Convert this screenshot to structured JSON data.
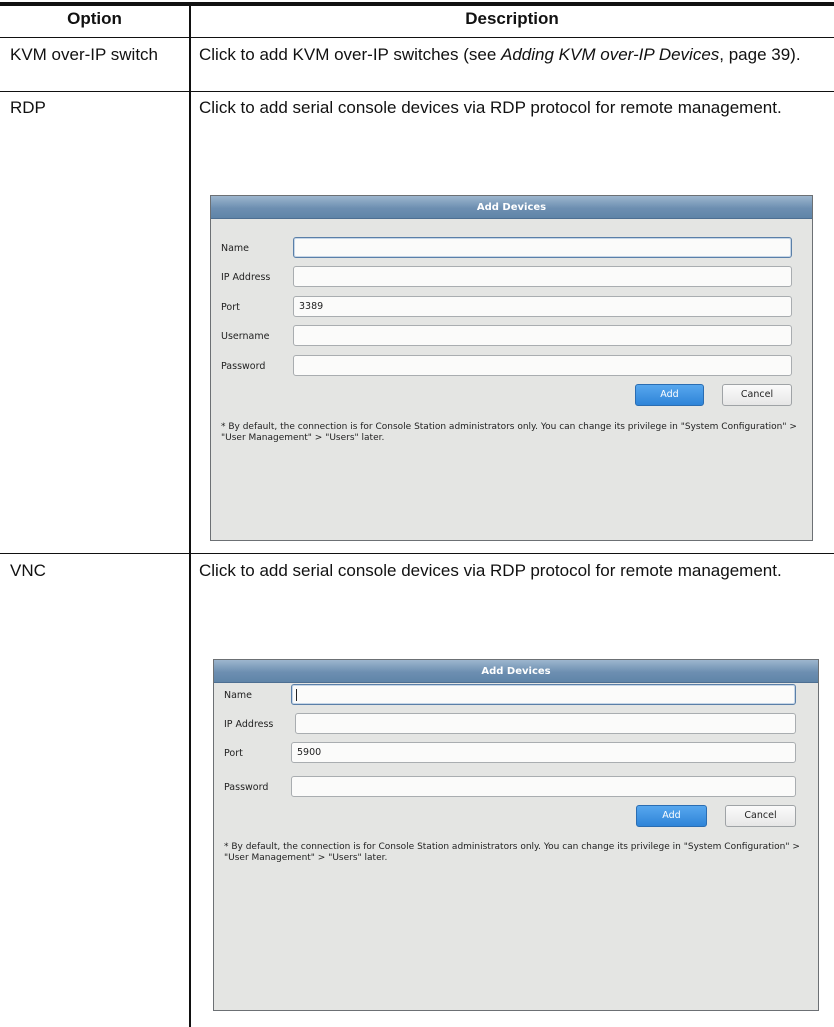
{
  "table": {
    "headers": {
      "option": "Option",
      "description": "Description"
    },
    "rows": [
      {
        "option": "KVM over-IP switch",
        "desc_pre": "Click to add KVM over-IP switches (see ",
        "desc_link": "Adding KVM over-IP Devices",
        "desc_post": ", page 39)."
      },
      {
        "option": "RDP",
        "description": "Click to add serial console devices via RDP protocol for remote management."
      },
      {
        "option": "VNC",
        "description": "Click to add serial console devices via RDP protocol for remote management."
      }
    ]
  },
  "dialogs": {
    "rdp": {
      "title": "Add Devices",
      "fields": [
        {
          "label": "Name",
          "value": ""
        },
        {
          "label": "IP Address",
          "value": ""
        },
        {
          "label": "Port",
          "value": "3389"
        },
        {
          "label": "Username",
          "value": ""
        },
        {
          "label": "Password",
          "value": ""
        }
      ],
      "add_label": "Add",
      "cancel_label": "Cancel",
      "note": "* By default, the connection is for Console Station administrators only. You can change its privilege in \"System Configuration\" > \"User Management\" > \"Users\" later."
    },
    "vnc": {
      "title": "Add Devices",
      "fields": [
        {
          "label": "Name",
          "value": ""
        },
        {
          "label": "IP Address",
          "value": ""
        },
        {
          "label": "Port",
          "value": "5900"
        },
        {
          "label": "Password",
          "value": ""
        }
      ],
      "add_label": "Add",
      "cancel_label": "Cancel",
      "note": "* By default, the connection is for Console Station administrators only. You can change its privilege in \"System Configuration\" > \"User Management\" > \"Users\" later."
    }
  },
  "colors": {
    "title_bar": "#6d8fb1",
    "add_button": "#2e84d8",
    "dialog_bg": "#e4e5e3"
  }
}
